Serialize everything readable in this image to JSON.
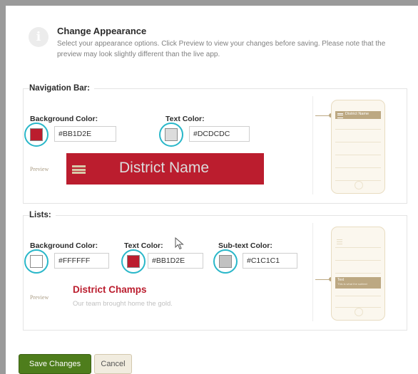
{
  "header": {
    "title": "Change Appearance",
    "description": "Select your appearance options. Click Preview to view your changes before saving. Please note that the preview may look slightly different than the live app.",
    "icon": "info-icon"
  },
  "nav_bar": {
    "title": "Navigation Bar:",
    "background_color": {
      "label": "Background Color:",
      "value": "#BB1D2E",
      "swatch": "#BB1D2E"
    },
    "text_color": {
      "label": "Text Color:",
      "value": "#DCDCDC",
      "swatch": "#DCDCDC"
    },
    "preview_label": "Preview",
    "preview_text": "District Name",
    "phone_preview_text": "District Name"
  },
  "lists": {
    "title": "Lists:",
    "background_color": {
      "label": "Background Color:",
      "value": "#FFFFFF",
      "swatch": "#FFFFFF"
    },
    "text_color": {
      "label": "Text Color:",
      "value": "#BB1D2E",
      "swatch": "#BB1D2E"
    },
    "subtext_color": {
      "label": "Sub-text Color:",
      "value": "#C1C1C1",
      "swatch": "#C1C1C1"
    },
    "preview_label": "Preview",
    "preview_title": "District Champs",
    "preview_subtitle": "Our team brought home the gold.",
    "phone_item_title": "Text",
    "phone_item_subtitle": "This is what the subtext"
  },
  "actions": {
    "save_label": "Save Changes",
    "cancel_label": "Cancel"
  },
  "colors": {
    "highlight_ring": "#29b7c9",
    "save_button": "#4e7d1c",
    "phone_accent": "#bca882"
  }
}
